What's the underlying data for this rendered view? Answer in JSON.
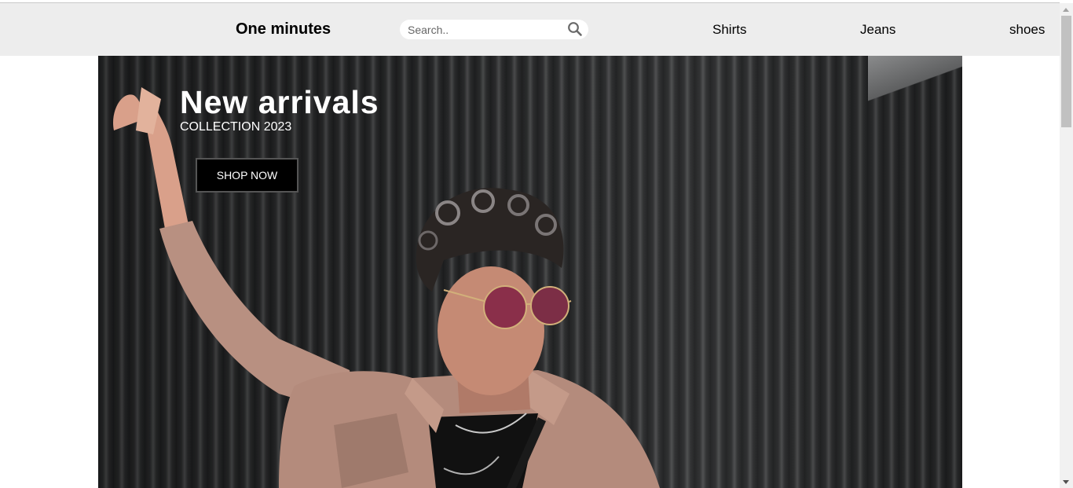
{
  "header": {
    "brand": "One minutes",
    "search": {
      "placeholder": "Search..",
      "value": ""
    },
    "nav": [
      {
        "label": "Shirts"
      },
      {
        "label": "Jeans"
      },
      {
        "label": "shoes"
      }
    ]
  },
  "hero": {
    "title": "New arrivals",
    "subtitle": "COLLECTION 2023",
    "cta_label": "SHOP NOW",
    "image_icon": "model-photo"
  },
  "colors": {
    "navbar_bg": "#ededed",
    "button_bg": "#000000",
    "button_text": "#ffffff",
    "hero_bg": "#2a2b2c"
  }
}
